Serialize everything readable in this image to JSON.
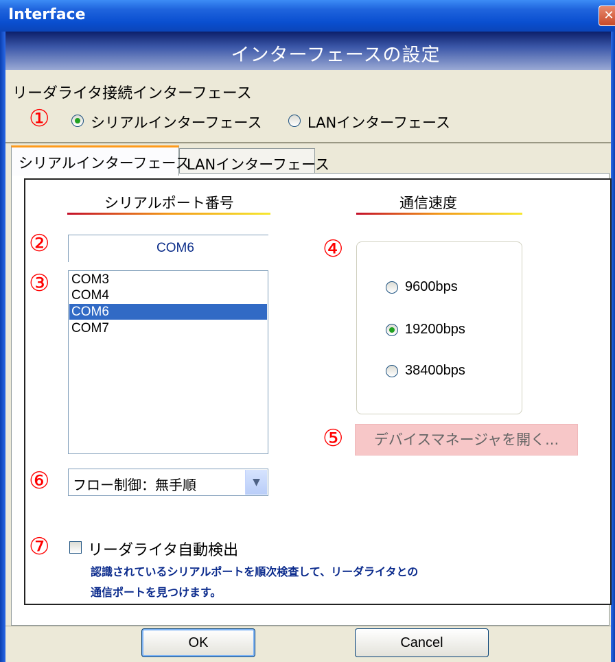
{
  "window": {
    "title": "Interface",
    "close_glyph": "✕"
  },
  "banner": {
    "title": "インターフェースの設定"
  },
  "connection": {
    "label": "リーダライタ接続インターフェース",
    "options": [
      {
        "label": "シリアルインターフェース",
        "selected": true
      },
      {
        "label": "LANインターフェース",
        "selected": false
      }
    ]
  },
  "tabs": [
    {
      "label": "シリアルインターフェース",
      "active": true
    },
    {
      "label": "LANインターフェース",
      "active": false
    }
  ],
  "serial_port": {
    "header": "シリアルポート番号",
    "selected_value": "COM6",
    "list": [
      "COM3",
      "COM4",
      "COM6",
      "COM7"
    ],
    "selected_index": 2
  },
  "speed": {
    "header": "通信速度",
    "options": [
      {
        "label": "9600bps",
        "selected": false
      },
      {
        "label": "19200bps",
        "selected": true
      },
      {
        "label": "38400bps",
        "selected": false
      }
    ]
  },
  "device_manager_button": "デバイスマネージャを開く...",
  "flow_control": {
    "value": "フロー制御：無手順"
  },
  "auto_detect": {
    "label": "リーダライタ自動検出",
    "checked": false,
    "description_line1": "認識されているシリアルポートを順次検査して、リーダライタとの",
    "description_line2": "通信ポートを見つけます。"
  },
  "buttons": {
    "ok": "OK",
    "cancel": "Cancel"
  },
  "markers": [
    "①",
    "②",
    "③",
    "④",
    "⑤",
    "⑥",
    "⑦"
  ],
  "colors": {
    "marker_red": "#ff0000",
    "selection_blue": "#316ac5",
    "title_blue": "#0a4fd0",
    "device_button_pink": "#f7c7c8",
    "radio_dot_green": "#21a121"
  },
  "icons": {
    "dropdown": "chevron-down-icon",
    "close": "close-icon"
  }
}
